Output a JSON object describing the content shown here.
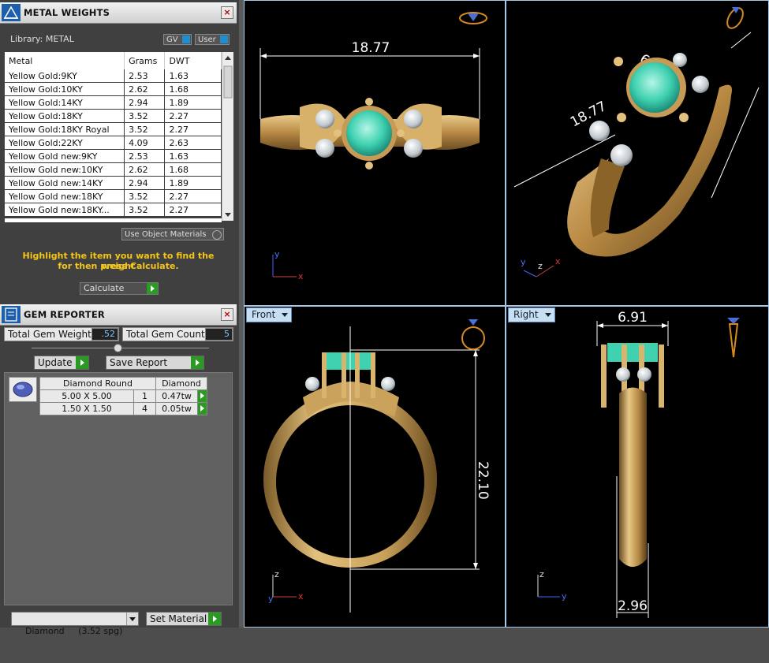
{
  "metal_panel": {
    "title": "METAL WEIGHTS",
    "library_label": "Library: METAL",
    "gv_label": "GV",
    "user_label": "User",
    "columns": [
      "Metal",
      "Grams",
      "DWT"
    ],
    "rows": [
      [
        "Yellow Gold:9KY",
        "2.53",
        "1.63"
      ],
      [
        "Yellow Gold:10KY",
        "2.62",
        "1.68"
      ],
      [
        "Yellow Gold:14KY",
        "2.94",
        "1.89"
      ],
      [
        "Yellow Gold:18KY",
        "3.52",
        "2.27"
      ],
      [
        "Yellow Gold:18KY Royal",
        "3.52",
        "2.27"
      ],
      [
        "Yellow Gold:22KY",
        "4.09",
        "2.63"
      ],
      [
        "Yellow Gold new:9KY",
        "2.53",
        "1.63"
      ],
      [
        "Yellow Gold new:10KY",
        "2.62",
        "1.68"
      ],
      [
        "Yellow Gold new:14KY",
        "2.94",
        "1.89"
      ],
      [
        "Yellow Gold new:18KY",
        "3.52",
        "2.27"
      ],
      [
        "Yellow Gold new:18KY...",
        "3.52",
        "2.27"
      ]
    ],
    "use_object_materials": "Use Object Materials",
    "hint_line1": "Highlight the item you want to find the weight",
    "hint_line2": "for then press Calculate.",
    "calculate_label": "Calculate"
  },
  "gem_panel": {
    "title": "GEM REPORTER",
    "total_weight_label": "Total Gem Weight",
    "total_weight_value": ".52",
    "total_count_label": "Total Gem Count",
    "total_count_value": "5",
    "update_label": "Update",
    "save_report_label": "Save Report",
    "table_headers": [
      "Diamond Round",
      "Diamond"
    ],
    "rows": [
      {
        "size": "5.00 X 5.00",
        "count": "1",
        "weight": "0.47tw"
      },
      {
        "size": "1.50 X 1.50",
        "count": "4",
        "weight": "0.05tw"
      }
    ]
  },
  "material_select": {
    "value": "Diamond     (3.52 spg)",
    "set_material_label": "Set Material"
  },
  "viewports": {
    "top": {
      "dimension": "18.77",
      "axis_y": "y",
      "axis_x": "x"
    },
    "perspective": {
      "dimension_a": "18.77",
      "dimension_b": "6.91",
      "axis_y": "y",
      "axis_z": "z",
      "axis_x": "x"
    },
    "front": {
      "label": "Front",
      "dimension": "22.10",
      "axis_z": "z",
      "axis_y": "y",
      "axis_x": "x"
    },
    "right": {
      "label": "Right",
      "dimension_top": "6.91",
      "dimension_bottom": "2.96",
      "axis_z": "z",
      "axis_y": "y"
    }
  },
  "colors": {
    "gold": "#c9a05a",
    "emerald": "#3fd1b0",
    "dim_line": "#ffffff",
    "hint": "#f5c518",
    "go_button": "#2b9a22"
  }
}
